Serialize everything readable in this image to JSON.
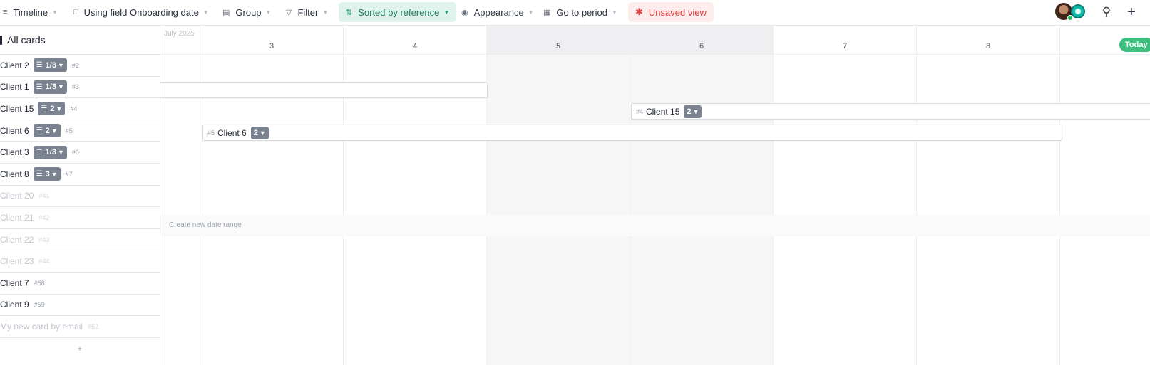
{
  "toolbar": {
    "view": {
      "label": "Timeline",
      "icon": "timeline-icon"
    },
    "field": {
      "label": "Using field Onboarding date",
      "icon": "calendar-field-icon"
    },
    "group": {
      "label": "Group",
      "icon": "stack-icon"
    },
    "filter": {
      "label": "Filter",
      "icon": "filter-icon"
    },
    "sort": {
      "label": "Sorted by reference",
      "icon": "sort-icon",
      "color": "#dff3ec"
    },
    "appearance": {
      "label": "Appearance",
      "icon": "eye-icon"
    },
    "goto": {
      "label": "Go to period",
      "icon": "calendar-icon"
    },
    "unsaved": {
      "label": "Unsaved view",
      "icon": "asterisk-icon",
      "color": "#fdecec"
    }
  },
  "left_panel": {
    "title": "All cards",
    "cards": [
      {
        "name": "Client 2",
        "badge": "1/3",
        "badge_type": "checklist",
        "ref": "#2",
        "faded": false
      },
      {
        "name": "Client 1",
        "badge": "1/3",
        "badge_type": "checklist",
        "ref": "#3",
        "faded": false
      },
      {
        "name": "Client 15",
        "badge": "2",
        "badge_type": "checklist",
        "ref": "#4",
        "faded": false
      },
      {
        "name": "Client 6",
        "badge": "2",
        "badge_type": "checklist",
        "ref": "#5",
        "faded": false
      },
      {
        "name": "Client 3",
        "badge": "1/3",
        "badge_type": "checklist",
        "ref": "#6",
        "faded": false
      },
      {
        "name": "Client 8",
        "badge": "3",
        "badge_type": "checklist",
        "ref": "#7",
        "faded": false
      },
      {
        "name": "Client 20",
        "badge": "",
        "ref": "#41",
        "faded": true
      },
      {
        "name": "Client 21",
        "badge": "",
        "ref": "#42",
        "faded": true
      },
      {
        "name": "Client 22",
        "badge": "",
        "ref": "#43",
        "faded": true
      },
      {
        "name": "Client 23",
        "badge": "",
        "ref": "#44",
        "faded": true
      },
      {
        "name": "Client 7",
        "badge": "",
        "ref": "#58",
        "faded": false
      },
      {
        "name": "Client 9",
        "badge": "",
        "ref": "#59",
        "faded": false
      },
      {
        "name": "My new card by email",
        "badge": "",
        "ref": "#62",
        "faded": true
      }
    ],
    "add_label": "+"
  },
  "timeline": {
    "month": "July 2025",
    "days": [
      "3",
      "4",
      "5",
      "6",
      "7",
      "8"
    ],
    "weekend_days": [
      "5",
      "6"
    ],
    "today_label": "Today",
    "create_hint": "Create new date range",
    "bars": [
      {
        "row": 1,
        "ref": "",
        "name": "",
        "badge": "",
        "start": "2",
        "end": "4"
      },
      {
        "row": 2,
        "ref": "#4",
        "name": "Client 15",
        "badge": "2",
        "start": "6",
        "end": "9+"
      },
      {
        "row": 3,
        "ref": "#5",
        "name": "Client 6",
        "badge": "2",
        "start": "3",
        "end": "8"
      }
    ]
  },
  "colors": {
    "accent_green": "#3ebf7f",
    "badge_gray": "#7b8290",
    "unsaved_red": "#e23b3b",
    "sorted_green": "#1e7f5c"
  }
}
